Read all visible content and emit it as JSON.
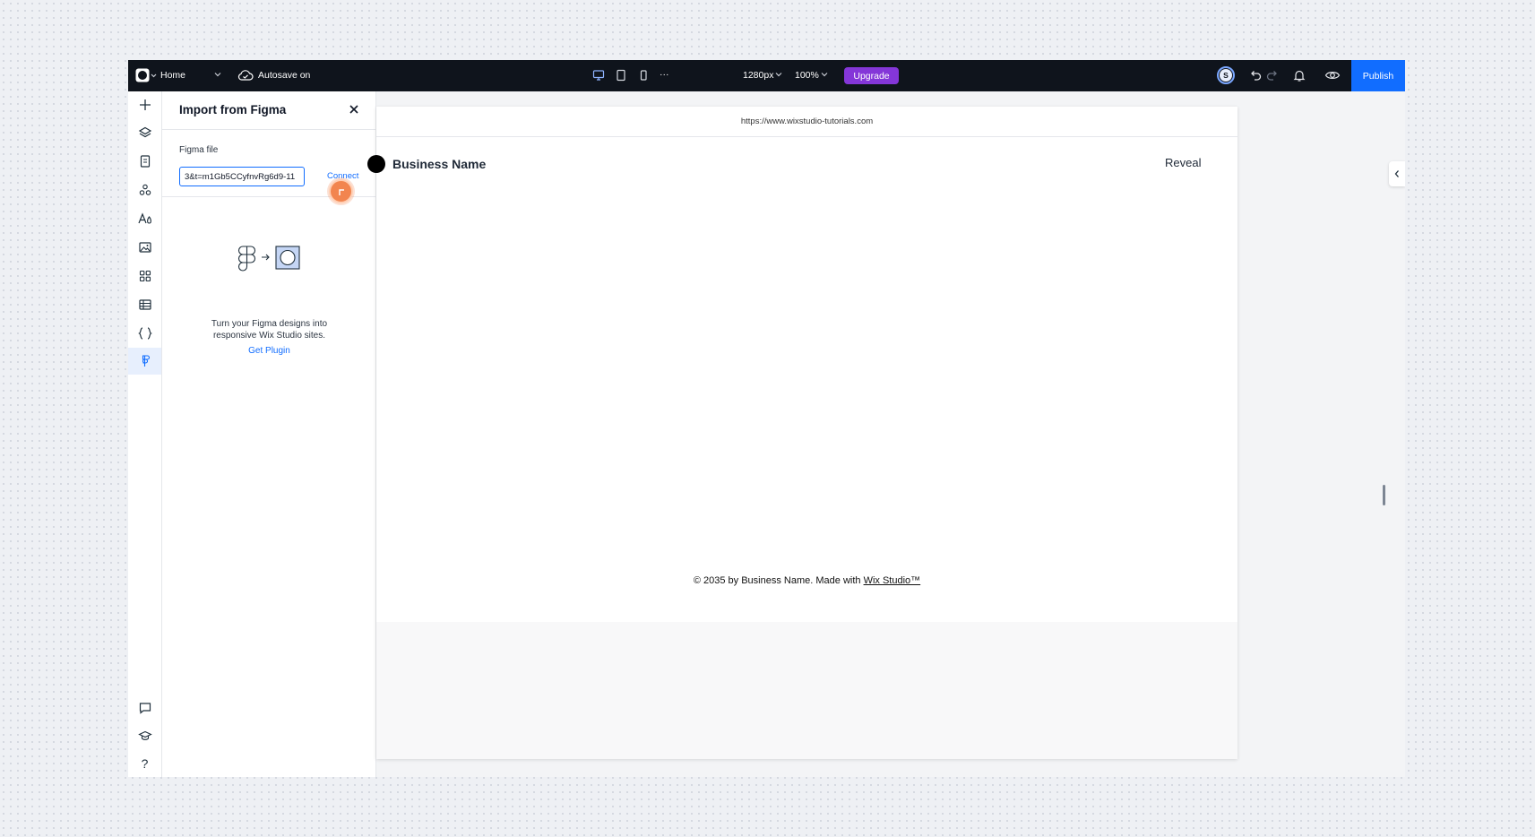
{
  "topbar": {
    "page_name": "Home",
    "autosave_label": "Autosave on",
    "more_label": "···",
    "width_value": "1280px",
    "zoom_value": "100%",
    "upgrade_label": "Upgrade",
    "avatar_initial": "S",
    "publish_label": "Publish"
  },
  "rail": {
    "items": [
      "add",
      "layers",
      "pages",
      "components",
      "text-themes",
      "media",
      "apps",
      "cms",
      "code",
      "figma"
    ],
    "bottom_items": [
      "comments",
      "academy",
      "help"
    ],
    "help_glyph": "?"
  },
  "panel": {
    "title": "Import from Figma",
    "field_label": "Figma file",
    "input_value": "3&t=m1Gb5CCyfnvRg6d9-11",
    "connect_label": "Connect",
    "helper_text_line1": "Turn your Figma designs into",
    "helper_text_line2": "responsive Wix Studio sites.",
    "get_plugin_label": "Get Plugin"
  },
  "site": {
    "url": "https://www.wixstudio-tutorials.com",
    "business_name": "Business Name",
    "reveal_label": "Reveal",
    "footer_prefix": "© 2035 by Business Name. Made with ",
    "footer_link": "Wix Studio™"
  },
  "colors": {
    "accent": "#116dff",
    "upgrade": "#8436d8",
    "topbar": "#0f141c",
    "cursor": "#f2854f"
  }
}
